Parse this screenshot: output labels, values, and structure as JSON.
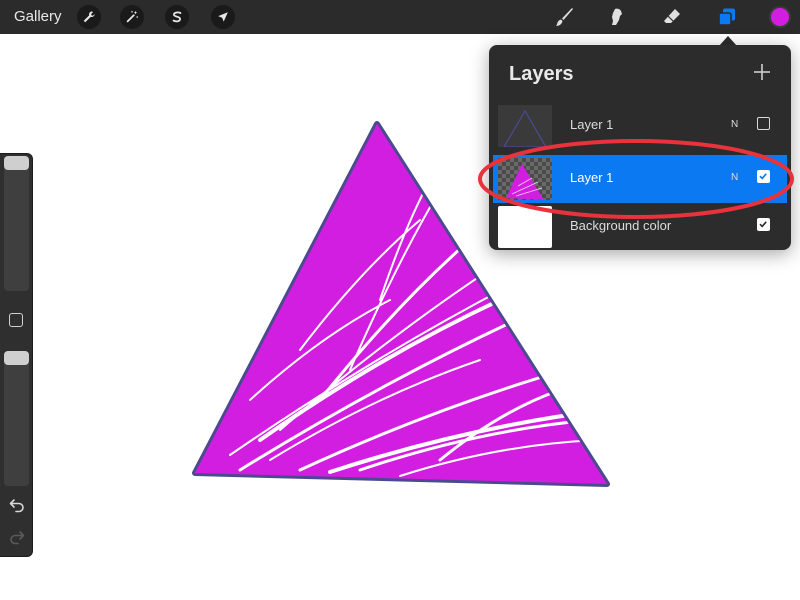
{
  "toolbar": {
    "gallery_label": "Gallery",
    "left_tools": [
      "wrench-icon",
      "magic-wand-icon",
      "selection-icon",
      "transform-arrow-icon"
    ],
    "right_tools": [
      "brush-icon",
      "smudge-icon",
      "eraser-icon",
      "layers-icon"
    ],
    "current_color": "#d21ee0",
    "active_tool_color": "#0a79f2"
  },
  "sidebar": {
    "brush_size_level": 0.0,
    "opacity_level": 0.0,
    "icons": [
      "square-modify-icon",
      "undo-icon",
      "redo-icon"
    ]
  },
  "layers": {
    "title": "Layers",
    "add_icon": "plus-icon",
    "rows": [
      {
        "name": "Layer 1",
        "mode": "N",
        "visible": false,
        "selected": false
      },
      {
        "name": "Layer 1",
        "mode": "N",
        "visible": true,
        "selected": true
      },
      {
        "name": "Background color",
        "mode": "",
        "visible": true,
        "selected": false
      }
    ]
  },
  "canvas": {
    "fill_color": "#d21ee0",
    "outline_color": "#4b4a8f",
    "background": "#ffffff"
  },
  "annotation": {
    "shape": "ellipse",
    "color": "#e8323c",
    "target": "layers.rows.1"
  }
}
